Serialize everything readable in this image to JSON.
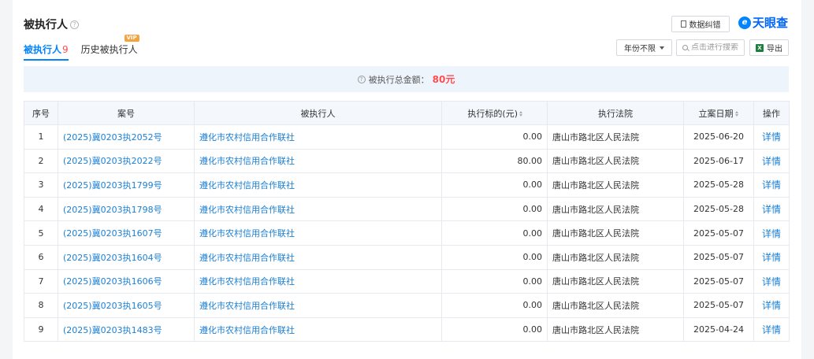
{
  "header": {
    "title": "被执行人",
    "help_icon": "question-circle-icon",
    "report_button": "数据纠错",
    "logo_text": "天眼查",
    "logo_color": "#0066ff"
  },
  "tabs": [
    {
      "label": "被执行人",
      "count": "9",
      "active": true
    },
    {
      "label": "历史被执行人",
      "badge": "VIP",
      "active": false
    }
  ],
  "toolbar": {
    "year_filter": "年份不限",
    "search_placeholder": "点击进行搜索",
    "export_label": "导出"
  },
  "summary": {
    "label": "被执行总金额：",
    "amount": "80元",
    "amount_color": "#ff4d4f"
  },
  "table": {
    "columns": [
      "序号",
      "案号",
      "被执行人",
      "执行标的(元)",
      "执行法院",
      "立案日期",
      "操作"
    ],
    "rows": [
      {
        "idx": "1",
        "case_no": "(2025)冀0203执2052号",
        "party": "遵化市农村信用合作联社",
        "amount": "0.00",
        "court": "唐山市路北区人民法院",
        "date": "2025-06-20",
        "action": "详情"
      },
      {
        "idx": "2",
        "case_no": "(2025)冀0203执2022号",
        "party": "遵化市农村信用合作联社",
        "amount": "80.00",
        "court": "唐山市路北区人民法院",
        "date": "2025-06-17",
        "action": "详情"
      },
      {
        "idx": "3",
        "case_no": "(2025)冀0203执1799号",
        "party": "遵化市农村信用合作联社",
        "amount": "0.00",
        "court": "唐山市路北区人民法院",
        "date": "2025-05-28",
        "action": "详情"
      },
      {
        "idx": "4",
        "case_no": "(2025)冀0203执1798号",
        "party": "遵化市农村信用合作联社",
        "amount": "0.00",
        "court": "唐山市路北区人民法院",
        "date": "2025-05-28",
        "action": "详情"
      },
      {
        "idx": "5",
        "case_no": "(2025)冀0203执1607号",
        "party": "遵化市农村信用合作联社",
        "amount": "0.00",
        "court": "唐山市路北区人民法院",
        "date": "2025-05-07",
        "action": "详情"
      },
      {
        "idx": "6",
        "case_no": "(2025)冀0203执1604号",
        "party": "遵化市农村信用合作联社",
        "amount": "0.00",
        "court": "唐山市路北区人民法院",
        "date": "2025-05-07",
        "action": "详情"
      },
      {
        "idx": "7",
        "case_no": "(2025)冀0203执1606号",
        "party": "遵化市农村信用合作联社",
        "amount": "0.00",
        "court": "唐山市路北区人民法院",
        "date": "2025-05-07",
        "action": "详情"
      },
      {
        "idx": "8",
        "case_no": "(2025)冀0203执1605号",
        "party": "遵化市农村信用合作联社",
        "amount": "0.00",
        "court": "唐山市路北区人民法院",
        "date": "2025-05-07",
        "action": "详情"
      },
      {
        "idx": "9",
        "case_no": "(2025)冀0203执1483号",
        "party": "遵化市农村信用合作联社",
        "amount": "0.00",
        "court": "唐山市路北区人民法院",
        "date": "2025-04-24",
        "action": "详情"
      }
    ]
  }
}
